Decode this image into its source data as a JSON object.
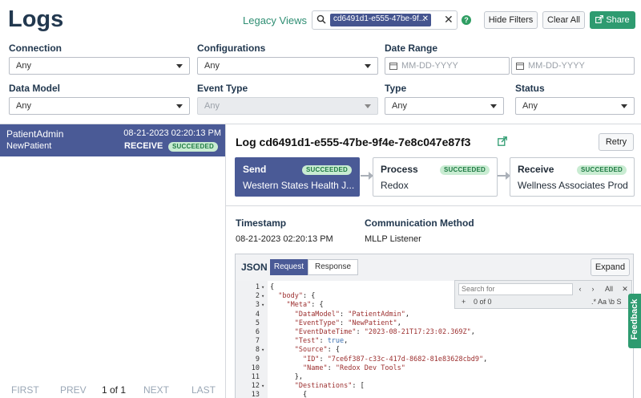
{
  "header": {
    "title": "Logs",
    "legacy_link": "Legacy Views",
    "search_chip": "cd6491d1-e555-47be-9f...",
    "help": "?",
    "hide_filters": "Hide Filters",
    "clear_all": "Clear All",
    "share": "Share"
  },
  "filters": {
    "connection": {
      "label": "Connection",
      "value": "Any"
    },
    "configurations": {
      "label": "Configurations",
      "value": "Any"
    },
    "date_range": {
      "label": "Date Range",
      "start_placeholder": "MM-DD-YYYY",
      "end_placeholder": "MM-DD-YYYY"
    },
    "data_model": {
      "label": "Data Model",
      "value": "Any"
    },
    "event_type": {
      "label": "Event Type",
      "value": "Any"
    },
    "type": {
      "label": "Type",
      "value": "Any"
    },
    "status": {
      "label": "Status",
      "value": "Any"
    }
  },
  "log_list": {
    "items": [
      {
        "data_model": "PatientAdmin",
        "event": "NewPatient",
        "timestamp": "08-21-2023 02:20:13 PM",
        "direction": "RECEIVE",
        "status": "SUCCEEDED"
      }
    ],
    "pager": {
      "first": "FIRST",
      "prev": "PREV",
      "current": "1 of 1",
      "next": "NEXT",
      "last": "LAST"
    }
  },
  "detail": {
    "title": "Log cd6491d1-e555-47be-9f4e-7e8c047e87f3",
    "retry": "Retry",
    "steps": [
      {
        "name": "Send",
        "status": "SUCCEEDED",
        "sub": "Western States Health J..."
      },
      {
        "name": "Process",
        "status": "SUCCEEDED",
        "sub": "Redox"
      },
      {
        "name": "Receive",
        "status": "SUCCEEDED",
        "sub": "Wellness Associates Prod"
      }
    ],
    "timestamp_label": "Timestamp",
    "timestamp_value": "08-21-2023 02:20:13 PM",
    "comm_label": "Communication Method",
    "comm_value": "MLLP Listener",
    "json": {
      "label": "JSON",
      "tab_request": "Request",
      "tab_response": "Response",
      "expand": "Expand",
      "find_placeholder": "Search for",
      "find_all": "All",
      "find_count": "0 of 0",
      "find_opts": ".* Aa \\b S",
      "lines": [
        "{",
        "  \"body\": {",
        "    \"Meta\": {",
        "      \"DataModel\": \"PatientAdmin\",",
        "      \"EventType\": \"NewPatient\",",
        "      \"EventDateTime\": \"2023-08-21T17:23:02.369Z\",",
        "      \"Test\": true,",
        "      \"Source\": {",
        "        \"ID\": \"7ce6f387-c33c-417d-8682-81e83628cbd9\",",
        "        \"Name\": \"Redox Dev Tools\"",
        "      },",
        "      \"Destinations\": [",
        "        {"
      ]
    }
  },
  "feedback": "Feedback"
}
